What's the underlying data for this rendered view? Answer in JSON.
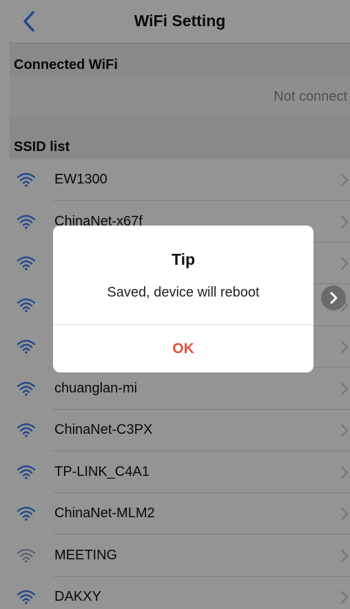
{
  "header": {
    "title": "WiFi Setting"
  },
  "connected": {
    "heading": "Connected WiFi",
    "value": "Not connect"
  },
  "ssid": {
    "heading": "SSID list",
    "items": [
      {
        "name": "EW1300"
      },
      {
        "name": "ChinaNet-x67f"
      },
      {
        "name": ""
      },
      {
        "name": ""
      },
      {
        "name": ""
      },
      {
        "name": "chuanglan-mi"
      },
      {
        "name": "ChinaNet-C3PX"
      },
      {
        "name": "TP-LINK_C4A1"
      },
      {
        "name": "ChinaNet-MLM2"
      },
      {
        "name": "MEETING"
      },
      {
        "name": "DAKXY"
      }
    ]
  },
  "dialog": {
    "title": "Tip",
    "message": "Saved, device will reboot",
    "ok_label": "OK"
  },
  "colors": {
    "accent": "#3478f6",
    "ok": "#e0533f",
    "wifi_strong": "#3a7df0",
    "wifi_weak": "#9aa8c0"
  }
}
